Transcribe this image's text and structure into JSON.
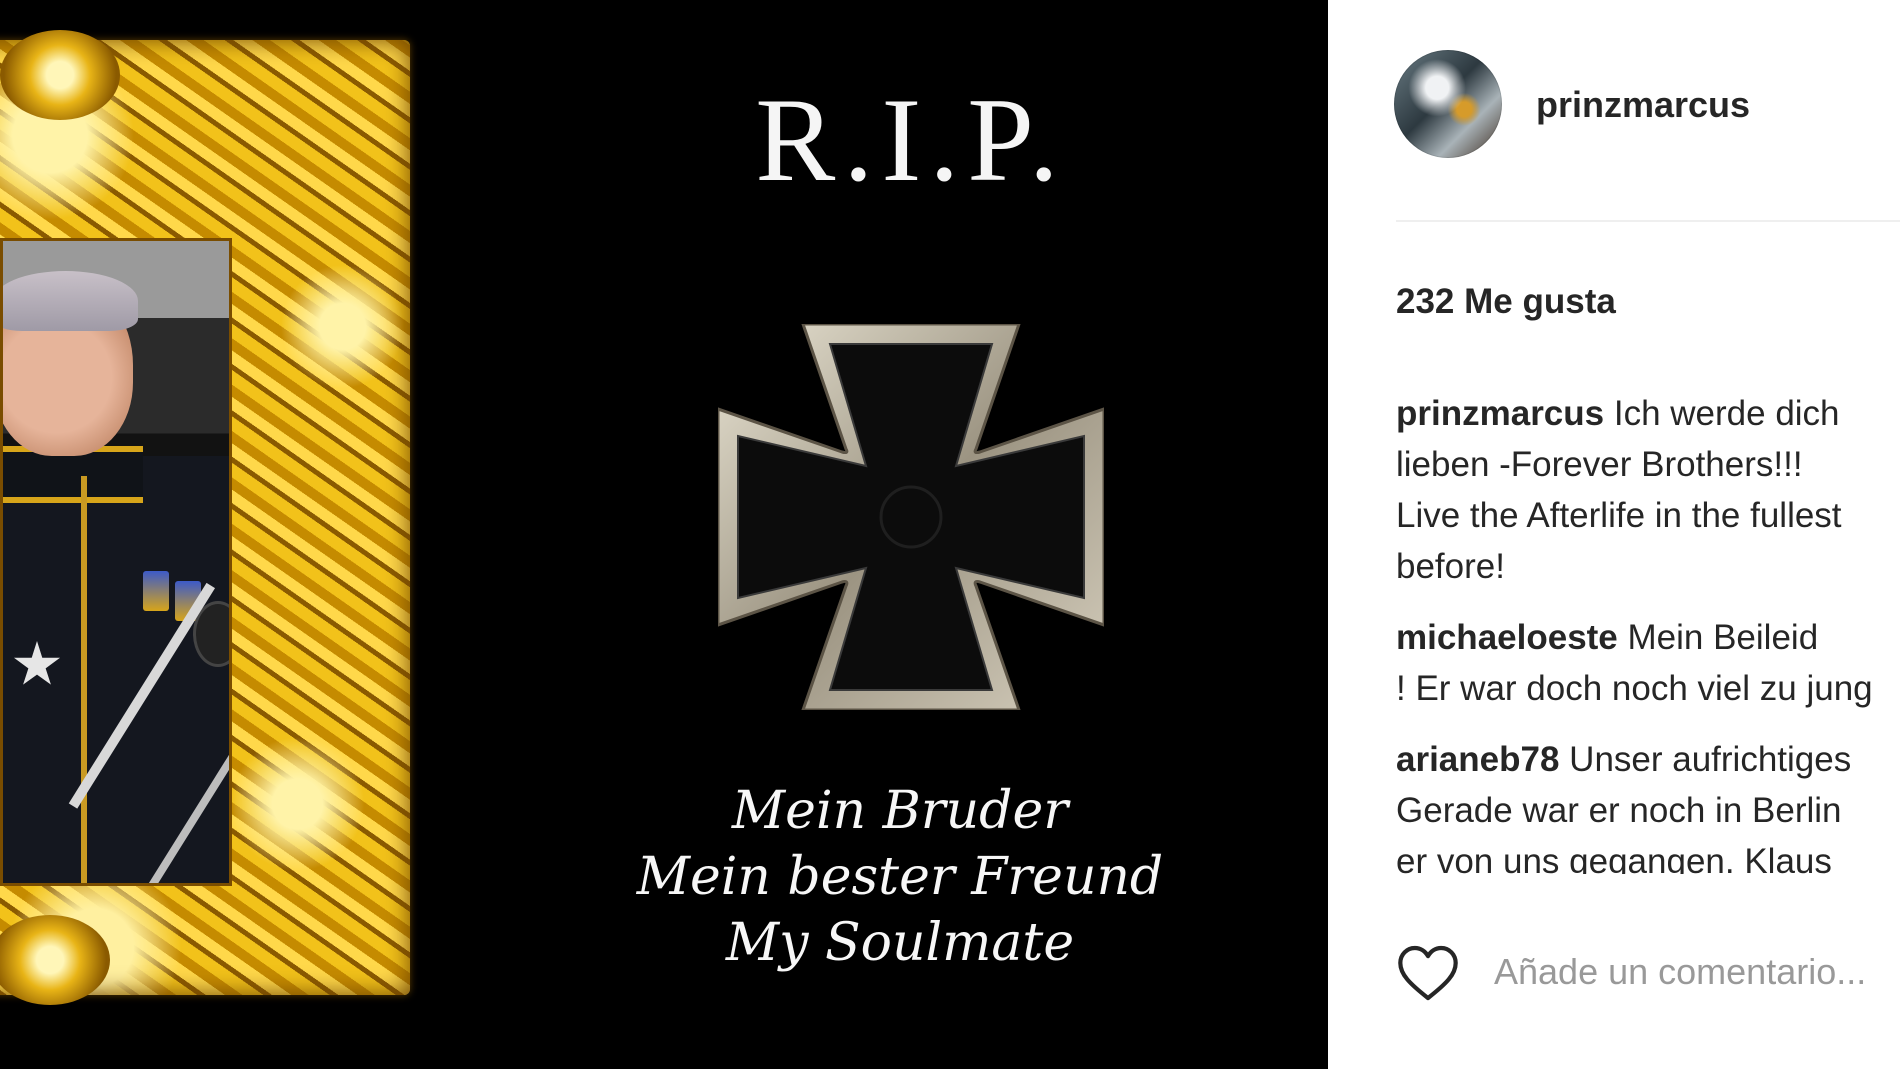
{
  "post_image": {
    "title": "R.I.P.",
    "lines": [
      "Mein Bruder",
      "Mein bester Freund",
      "My Soulmate"
    ]
  },
  "header": {
    "username": "prinzmarcus"
  },
  "likes": "232 Me gusta",
  "comments": [
    {
      "user": "prinzmarcus",
      "lines": [
        " Ich werde dich",
        "lieben -Forever Brothers!!!",
        "Live the Afterlife in the fullest",
        "before!"
      ]
    },
    {
      "user": "michaeloeste",
      "lines": [
        " Mein Beileid",
        "! Er war doch noch viel zu jung"
      ]
    },
    {
      "user": "arianeb78",
      "lines": [
        " Unser aufrichtiges",
        "Gerade war er noch in Berlin",
        "er von uns gegangen. Klaus"
      ]
    }
  ],
  "comment_box": {
    "placeholder": "Añade un comentario..."
  },
  "icons": {
    "like": "heart-icon"
  }
}
